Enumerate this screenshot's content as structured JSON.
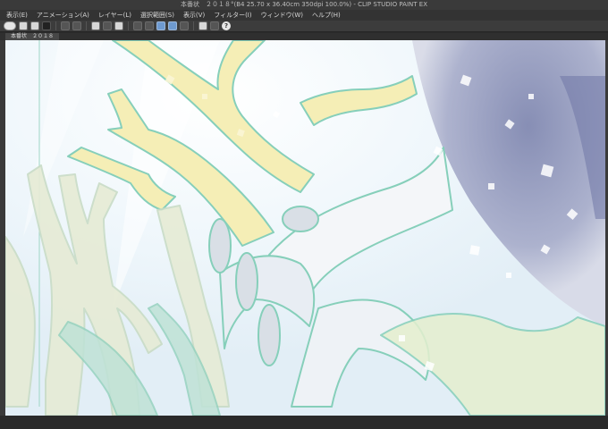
{
  "window": {
    "title": "本番状　２０１８°(B4 25.70 x 36.40cm 350dpi 100.0%) - CLIP STUDIO PAINT EX"
  },
  "menubar": {
    "items": [
      "表示(E)",
      "アニメーション(A)",
      "レイヤー(L)",
      "選択範囲(S)",
      "表示(V)",
      "フィルター(I)",
      "ウィンドウ(W)",
      "ヘルプ(H)"
    ]
  },
  "toolbar": {
    "icons": [
      "eye-icon",
      "new-file-icon",
      "open-icon",
      "save-icon",
      "undo-icon",
      "redo-icon",
      "transform-icon",
      "crop-icon",
      "snap-icon",
      "ruler-icon",
      "selection-icon",
      "layer-icon",
      "help-icon"
    ],
    "help_label": "?"
  },
  "canvas_tab": {
    "label": "本番状　２０１８"
  },
  "colors": {
    "outline": "#8fd3c1",
    "coral_yellow": "#f4ecb0",
    "coral_faint": "#e3ead6",
    "paper": "#fbfcfd",
    "sky": "#eaf4fb",
    "indigo": "#8088b3"
  }
}
